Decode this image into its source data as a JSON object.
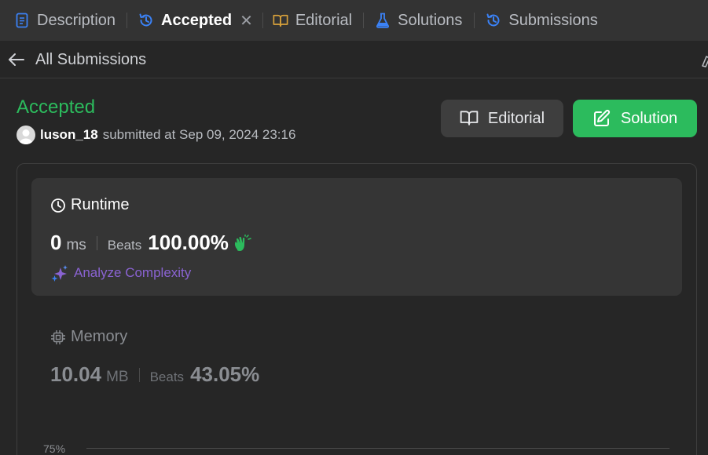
{
  "tabs": [
    {
      "label": "Description",
      "icon": "description-icon"
    },
    {
      "label": "Accepted",
      "icon": "history-icon",
      "active": true,
      "close": "✕"
    },
    {
      "label": "Editorial",
      "icon": "book-icon"
    },
    {
      "label": "Solutions",
      "icon": "flask-icon"
    },
    {
      "label": "Submissions",
      "icon": "history-icon"
    }
  ],
  "subheader": {
    "back_label": "All Submissions"
  },
  "submission": {
    "status": "Accepted",
    "username": "luson_18",
    "submitted_text": "submitted at Sep 09, 2024 23:16"
  },
  "actions": {
    "editorial_label": "Editorial",
    "solution_label": "Solution"
  },
  "runtime": {
    "title": "Runtime",
    "value": "0",
    "unit": "ms",
    "beats_label": "Beats",
    "beats_value": "100.00%",
    "analyze_label": "Analyze Complexity"
  },
  "memory": {
    "title": "Memory",
    "value": "10.04",
    "unit": "MB",
    "beats_label": "Beats",
    "beats_value": "43.05%"
  },
  "chart": {
    "first_tick": "75%"
  },
  "colors": {
    "accepted_green": "#2cbb5d",
    "analyze_purple": "#8a63d2",
    "tab_blue": "#3b82f6"
  }
}
